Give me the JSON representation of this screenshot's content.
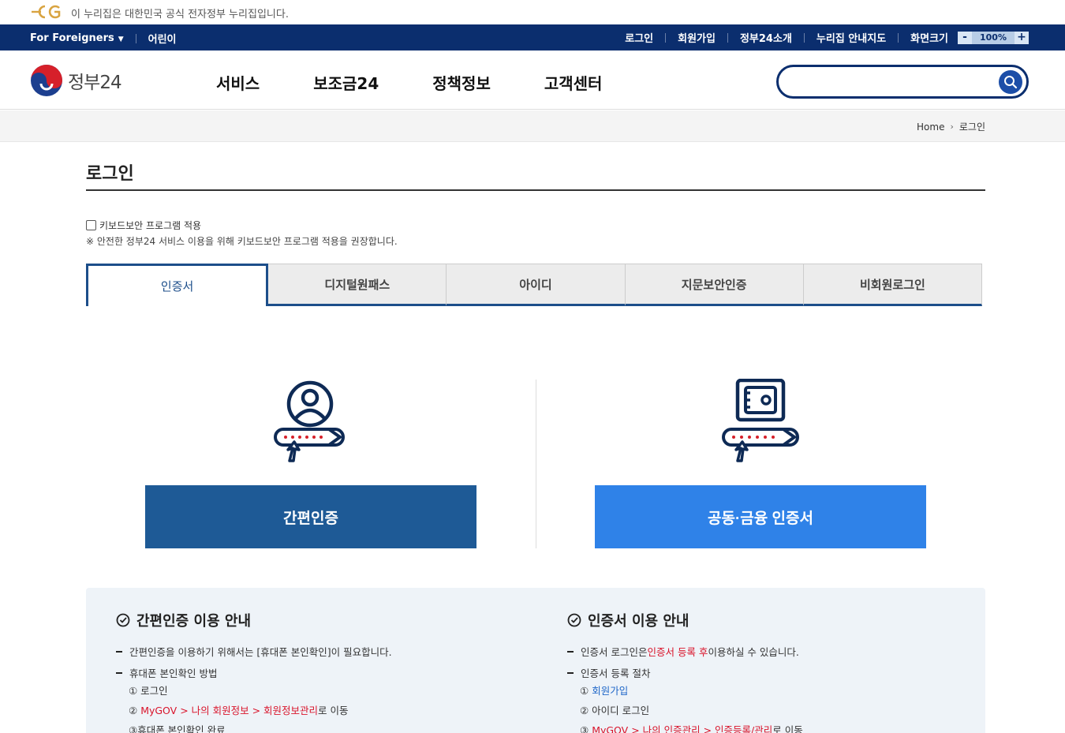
{
  "notice": {
    "text": "이 누리집은 대한민국 공식 전자정부 누리집입니다."
  },
  "util": {
    "foreigners": "For Foreigners",
    "kids": "어린이",
    "login": "로그인",
    "join": "회원가입",
    "about": "정부24소개",
    "sitemap": "누리집 안내지도",
    "screen_size": "화면크기",
    "zoom_minus": "-",
    "zoom_value": "100%",
    "zoom_plus": "+"
  },
  "header": {
    "logo_text": "정부24",
    "nav": [
      "서비스",
      "보조금24",
      "정책정보",
      "고객센터"
    ],
    "search_value": ""
  },
  "breadcrumb": {
    "home": "Home",
    "current": "로그인"
  },
  "page": {
    "title": "로그인",
    "keyboard_security": "키보드보안 프로그램 적용",
    "keyboard_note": "※ 안전한 정부24 서비스 이용을 위해 키보드보안 프로그램 적용을 권장합니다."
  },
  "tabs": [
    "인증서",
    "디지털원패스",
    "아이디",
    "지문보안인증",
    "비회원로그인"
  ],
  "options": {
    "simple_auth": "간편인증",
    "cert_auth": "공동·금융 인증서"
  },
  "guide": {
    "left": {
      "title": "간편인증 이용 안내",
      "item1": "간편인증을 이용하기 위해서는 [휴대폰 본인확인]이 필요합니다.",
      "item2": "휴대폰 본인확인 방법",
      "step1": "① 로그인",
      "step2_num": "② ",
      "step2_link": "MyGOV > 나의 회원정보 > 회원정보관리",
      "step2_tail": "로 이동",
      "step3": "③휴대폰 본인확인 완료"
    },
    "right": {
      "title": "인증서 이용 안내",
      "item1_pre": "인증서 로그인은 ",
      "item1_red": "인증서 등록 후",
      "item1_post": " 이용하실 수 있습니다.",
      "item2": "인증서 등록 절차",
      "step1_num": "① ",
      "step1_link": "회원가입",
      "step2": "② 아이디 로그인",
      "step3_num": "③ ",
      "step3_link": "MyGOV > 나의 인증관리 > 인증등록/관리",
      "step3_tail": "로 이동"
    }
  },
  "colors": {
    "navy": "#0b2e6e",
    "tab_blue": "#1c4e8a",
    "btn_dark": "#1e5a96",
    "btn_light": "#2f82e8",
    "red": "#d9142b"
  }
}
